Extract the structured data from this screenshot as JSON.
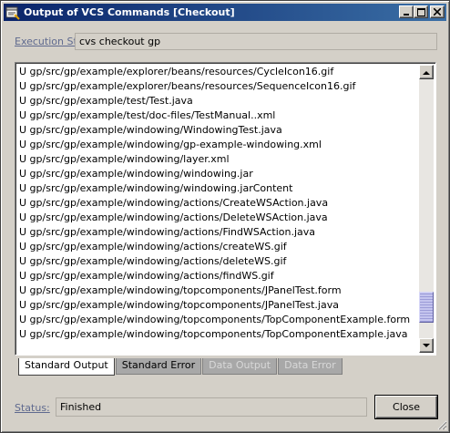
{
  "window": {
    "title": "Output of VCS Commands [Checkout]",
    "icon": "vcs-app-icon",
    "controls": [
      "minimize-icon",
      "maximize-icon",
      "close-icon"
    ]
  },
  "execution": {
    "label": "Execution String:",
    "value": "cvs  checkout gp"
  },
  "output": {
    "lines": [
      "U gp/src/gp/example/explorer/beans/resources/CycleIcon16.gif",
      "U gp/src/gp/example/explorer/beans/resources/SequenceIcon16.gif",
      "U gp/src/gp/example/test/Test.java",
      "U gp/src/gp/example/test/doc-files/TestManual..xml",
      "U gp/src/gp/example/windowing/WindowingTest.java",
      "U gp/src/gp/example/windowing/gp-example-windowing.xml",
      "U gp/src/gp/example/windowing/layer.xml",
      "U gp/src/gp/example/windowing/windowing.jar",
      "U gp/src/gp/example/windowing/windowing.jarContent",
      "U gp/src/gp/example/windowing/actions/CreateWSAction.java",
      "U gp/src/gp/example/windowing/actions/DeleteWSAction.java",
      "U gp/src/gp/example/windowing/actions/FindWSAction.java",
      "U gp/src/gp/example/windowing/actions/createWS.gif",
      "U gp/src/gp/example/windowing/actions/deleteWS.gif",
      "U gp/src/gp/example/windowing/actions/findWS.gif",
      "U gp/src/gp/example/windowing/topcomponents/JPanelTest.form",
      "U gp/src/gp/example/windowing/topcomponents/JPanelTest.java",
      "U gp/src/gp/example/windowing/topcomponents/TopComponentExample.form",
      "U gp/src/gp/example/windowing/topcomponents/TopComponentExample.java"
    ],
    "scroll_position": 0.93
  },
  "tabs": [
    {
      "label": "Standard Output",
      "state": "active"
    },
    {
      "label": "Standard Error",
      "state": "normal"
    },
    {
      "label": "Data Output",
      "state": "disabled"
    },
    {
      "label": "Data Error",
      "state": "disabled"
    }
  ],
  "status": {
    "label": "Status:",
    "value": "Finished"
  },
  "buttons": {
    "close_label": "Close"
  },
  "colors": {
    "title_start": "#0a246a",
    "title_end": "#3a6ea5",
    "label_color": "#5f6a8f",
    "face": "#d4d0c8"
  }
}
